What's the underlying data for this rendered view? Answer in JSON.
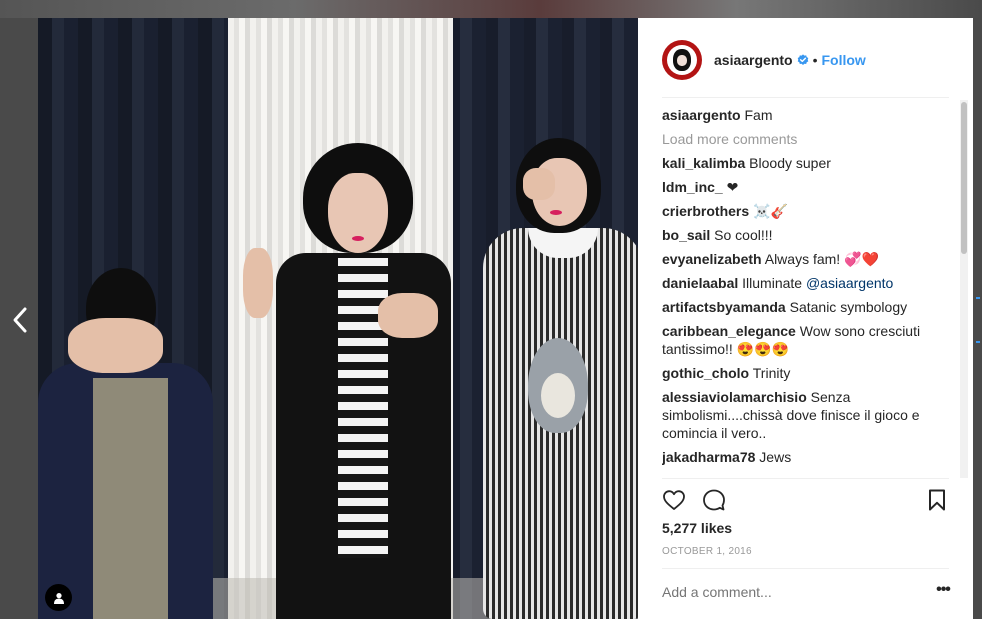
{
  "post": {
    "username": "asiaargento",
    "follow_label": "Follow",
    "caption_user": "asiaargento",
    "caption_text": "Fam",
    "load_more": "Load more comments",
    "likes": "5,277 likes",
    "date": "OCTOBER 1, 2016",
    "add_comment_placeholder": "Add a comment...",
    "more_label": "•••"
  },
  "comments": [
    {
      "user": "kali_kalimba",
      "text": "Bloody super"
    },
    {
      "user": "ldm_inc_",
      "text": "❤"
    },
    {
      "user": "crierbrothers",
      "text": "☠️🎸"
    },
    {
      "user": "bo_sail",
      "text": "So cool!!!"
    },
    {
      "user": "evyanelizabeth",
      "text": "Always fam! 💞❤️"
    },
    {
      "user": "danielaabal",
      "text": "Illuminate ",
      "mention": "@asiaargento"
    },
    {
      "user": "artifactsbyamanda",
      "text": "Satanic symbology"
    },
    {
      "user": "caribbean_elegance",
      "text": "Wow sono cresciuti tantissimo!! 😍😍😍"
    },
    {
      "user": "gothic_cholo",
      "text": "Trinity"
    },
    {
      "user": "alessiaviolamarchisio",
      "text": "Senza simbolismi....chissà dove finisce il gioco e comincia il vero.."
    },
    {
      "user": "jakadharma78",
      "text": "Jews"
    }
  ],
  "icons": {
    "prev": "chevron-left-icon",
    "like": "heart-icon",
    "comment": "comment-bubble-icon",
    "save": "bookmark-icon",
    "verified": "verified-badge-icon",
    "tagged": "user-tag-icon"
  },
  "colors": {
    "accent": "#3897f0",
    "text": "#262626",
    "muted": "#999999"
  }
}
